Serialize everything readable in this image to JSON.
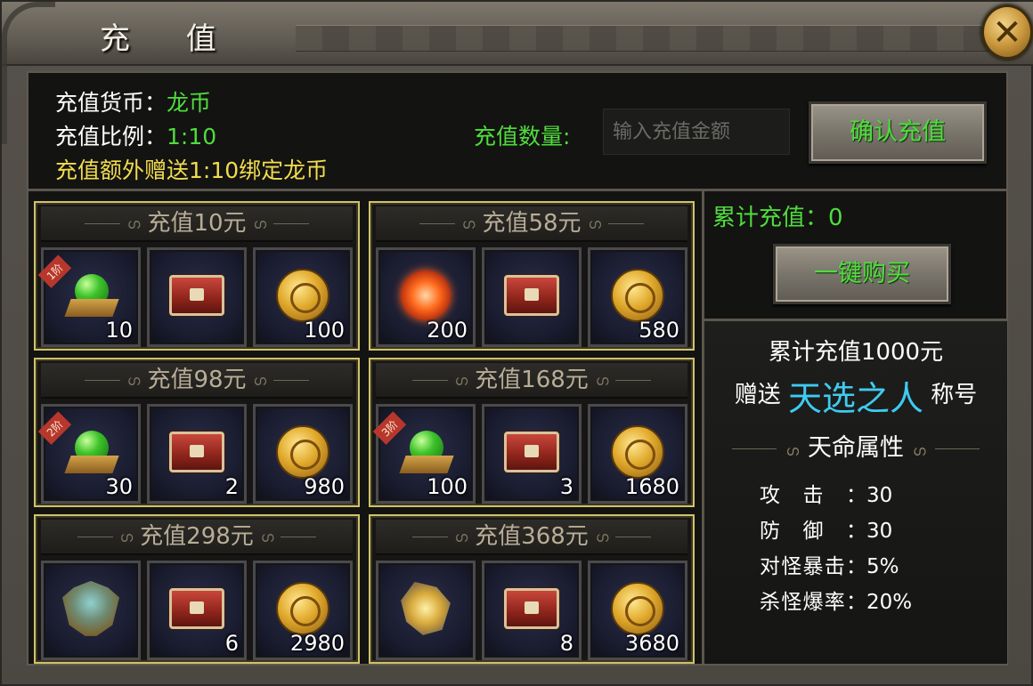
{
  "window": {
    "title": "充 值",
    "close_icon": "close-icon"
  },
  "info": {
    "currency_label": "充值货币：",
    "currency_value": "龙币",
    "ratio_label": "充值比例：",
    "ratio_value": "1:10",
    "bonus_text": "充值额外赠送1:10绑定龙币"
  },
  "recharge": {
    "qty_label": "充值数量:",
    "qty_placeholder": "输入充值金额",
    "confirm_label": "确认充值"
  },
  "packages": [
    {
      "title": "充值10元",
      "items": [
        {
          "icon": "green-gem-icon",
          "qty": "10",
          "tag": "1阶"
        },
        {
          "icon": "treasure-chest-icon",
          "qty": ""
        },
        {
          "icon": "gold-coin-icon",
          "qty": "100"
        }
      ]
    },
    {
      "title": "充值58元",
      "items": [
        {
          "icon": "fireball-icon",
          "qty": "200"
        },
        {
          "icon": "treasure-chest-icon",
          "qty": ""
        },
        {
          "icon": "gold-coin-icon",
          "qty": "580"
        }
      ]
    },
    {
      "title": "充值98元",
      "items": [
        {
          "icon": "green-gem-icon",
          "qty": "30",
          "tag": "2阶"
        },
        {
          "icon": "treasure-chest-icon",
          "qty": "2"
        },
        {
          "icon": "gold-coin-icon",
          "qty": "980"
        }
      ]
    },
    {
      "title": "充值168元",
      "items": [
        {
          "icon": "green-gem-icon",
          "qty": "100",
          "tag": "3阶"
        },
        {
          "icon": "treasure-chest-icon",
          "qty": "3"
        },
        {
          "icon": "gold-coin-icon",
          "qty": "1680"
        }
      ]
    },
    {
      "title": "充值298元",
      "items": [
        {
          "icon": "helmet-icon",
          "qty": ""
        },
        {
          "icon": "treasure-chest-icon",
          "qty": "6"
        },
        {
          "icon": "gold-coin-icon",
          "qty": "2980"
        }
      ]
    },
    {
      "title": "充值368元",
      "items": [
        {
          "icon": "golden-wing-icon",
          "qty": ""
        },
        {
          "icon": "treasure-chest-icon",
          "qty": "8"
        },
        {
          "icon": "gold-coin-icon",
          "qty": "3680"
        }
      ]
    }
  ],
  "side": {
    "total_label": "累计充值：0",
    "buy_all_label": "一键购买",
    "reward_line1": "累计充值1000元",
    "reward_gift": "赠送",
    "reward_title": "天选之人",
    "reward_suffix": "称号",
    "attr_heading": "天命属性",
    "attrs": [
      {
        "key": "攻击：",
        "value": "30"
      },
      {
        "key": "防御：",
        "value": "30"
      },
      {
        "key": "对怪暴击：",
        "value": "5%"
      },
      {
        "key": "杀怪爆率：",
        "value": "20%"
      }
    ]
  }
}
